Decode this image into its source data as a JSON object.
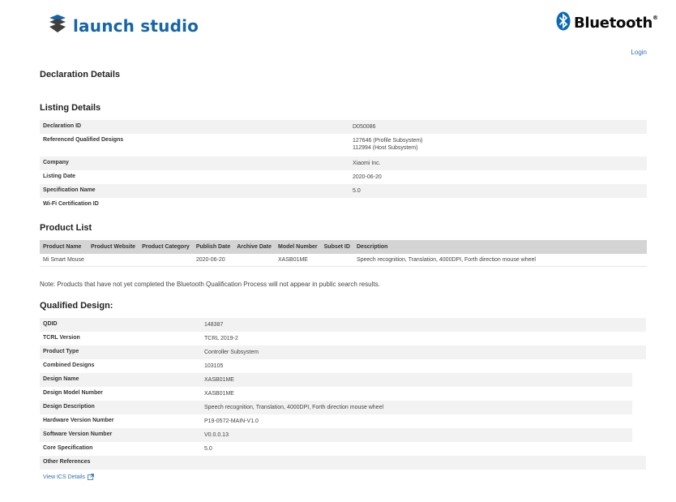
{
  "header": {
    "brand_text": "launch studio",
    "partner_logo_text": "Bluetooth",
    "partner_logo_mark": "®",
    "login_label": "Login"
  },
  "page_title": "Declaration Details",
  "listing": {
    "title": "Listing Details",
    "rows": [
      {
        "label": "Declaration ID",
        "value": "D050086"
      },
      {
        "label": "Referenced Qualified Designs",
        "value": "127646 (Profile Subsystem)\n112994 (Host Subsystem)"
      },
      {
        "label": "Company",
        "value": "Xiaomi Inc."
      },
      {
        "label": "Listing Date",
        "value": "2020-06-20"
      },
      {
        "label": "Specification Name",
        "value": "5.0"
      },
      {
        "label": "Wi-Fi Certification ID",
        "value": ""
      }
    ]
  },
  "products": {
    "title": "Product List",
    "columns": [
      "Product Name",
      "Product Website",
      "Product Category",
      "Publish Date",
      "Archive Date",
      "Model Number",
      "Subset ID",
      "Description"
    ],
    "rows": [
      [
        "Mi Smart Mouse",
        "",
        "",
        "2020-06-20",
        "",
        "XASB01ME",
        "",
        "Speech recognition, Translation, 4000DPI, Forth direction mouse wheel"
      ]
    ],
    "note": "Note: Products that have not yet completed the Bluetooth Qualification Process will not appear in public search results."
  },
  "qualified": {
    "title": "Qualified Design:",
    "rows": [
      {
        "label": "QDID",
        "value": "148387"
      },
      {
        "label": "TCRL Version",
        "value": "TCRL 2019-2"
      },
      {
        "label": "Product Type",
        "value": "Controller Subsystem"
      },
      {
        "label": "Combined Designs",
        "value": "103105"
      },
      {
        "label": "Design Name",
        "value": "XASB01ME"
      },
      {
        "label": "Design Model Number",
        "value": "XASB01ME"
      },
      {
        "label": "Design Description",
        "value": "Speech recognition, Translation, 4000DPI, Forth direction mouse wheel"
      },
      {
        "label": "Hardware Version Number",
        "value": "P19-0572-MAIN-V1.0"
      },
      {
        "label": "Software Version Number",
        "value": "V0.0.0.13"
      },
      {
        "label": "Core Specification",
        "value": "5.0"
      },
      {
        "label": "Other References",
        "value": ""
      }
    ],
    "ics_link_label": "View ICS Details"
  },
  "colors": {
    "brand_blue": "#1565a8",
    "link_blue": "#2e6fb5",
    "bluetooth_blue": "#0a6ab5",
    "row_stripe": "#f2f2f2",
    "table_header": "#d4d4d4"
  },
  "icons": {
    "brand_logo": "launch-studio-logo-icon",
    "bluetooth_logo": "bluetooth-rune-icon",
    "external_link": "external-link-icon"
  }
}
